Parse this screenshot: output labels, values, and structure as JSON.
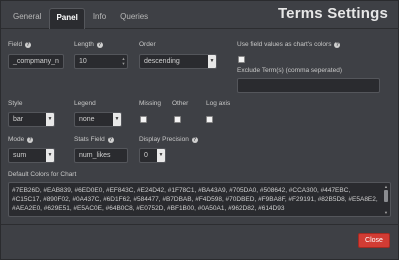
{
  "tabs": [
    {
      "label": "General"
    },
    {
      "label": "Panel"
    },
    {
      "label": "Info"
    },
    {
      "label": "Queries"
    }
  ],
  "title": "Terms Settings",
  "form": {
    "field": {
      "label": "Field",
      "value": "_compmany_n"
    },
    "length": {
      "label": "Length",
      "value": "10"
    },
    "order": {
      "label": "Order",
      "value": "descending"
    },
    "use_field_colors": {
      "label": "Use field values as chart's colors",
      "checked": false
    },
    "exclude_terms": {
      "label": "Exclude Term(s) (comma seperated)",
      "value": ""
    },
    "style": {
      "label": "Style",
      "value": "bar"
    },
    "legend": {
      "label": "Legend",
      "value": "none"
    },
    "missing": {
      "label": "Missing",
      "checked": false
    },
    "other": {
      "label": "Other",
      "checked": false
    },
    "log_axis": {
      "label": "Log axis",
      "checked": false
    },
    "mode": {
      "label": "Mode",
      "value": "sum"
    },
    "stats_field": {
      "label": "Stats Field",
      "value": "num_likes"
    },
    "display_precision": {
      "label": "Display Precision",
      "value": "0"
    },
    "default_colors": {
      "label": "Default Colors for Chart",
      "value": "#7EB26D, #EAB839, #6ED0E0, #EF843C, #E24D42, #1F78C1, #BA43A9, #705DA0, #508642, #CCA300, #447EBC, #C15C17, #890F02, #0A437C, #6D1F62, #584477, #B7DBAB, #F4D598, #70DBED, #F9BA8F, #F29191, #82B5D8, #E5A8E2, #AEA2E0, #629E51, #E5AC0E, #64B0C8, #E0752D, #BF1B00, #0A50A1, #962D82, #614D93"
    }
  },
  "footer": {
    "close_label": "Close"
  },
  "colors": {
    "close_button": "#D23C34",
    "background": "#3E4045"
  }
}
